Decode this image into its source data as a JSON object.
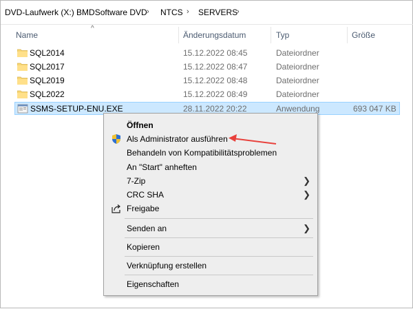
{
  "breadcrumb": {
    "items": [
      "DVD-Laufwerk (X:) BMDSoftware DVD",
      "NTCS",
      "SERVERS"
    ]
  },
  "columns": {
    "name": "Name",
    "date": "Änderungsdatum",
    "type": "Typ",
    "size": "Größe"
  },
  "files": [
    {
      "name": "SQL2014",
      "date": "15.12.2022 08:45",
      "type": "Dateiordner",
      "size": "",
      "icon": "folder-icon"
    },
    {
      "name": "SQL2017",
      "date": "15.12.2022 08:47",
      "type": "Dateiordner",
      "size": "",
      "icon": "folder-icon"
    },
    {
      "name": "SQL2019",
      "date": "15.12.2022 08:48",
      "type": "Dateiordner",
      "size": "",
      "icon": "folder-icon"
    },
    {
      "name": "SQL2022",
      "date": "15.12.2022 08:49",
      "type": "Dateiordner",
      "size": "",
      "icon": "folder-icon"
    },
    {
      "name": "SSMS-SETUP-ENU.EXE",
      "date": "28.11.2022 20:22",
      "type": "Anwendung",
      "size": "693 047 KB",
      "icon": "installer-icon",
      "selected": true
    }
  ],
  "context_menu": {
    "open": "Öffnen",
    "run_as_admin": "Als Administrator ausführen",
    "compat": "Behandeln von Kompatibilitätsproblemen",
    "pin_start": "An \"Start\" anheften",
    "zip": "7-Zip",
    "crc": "CRC SHA",
    "share": "Freigabe",
    "send_to": "Senden an",
    "copy": "Kopieren",
    "shortcut": "Verknüpfung erstellen",
    "properties": "Eigenschaften"
  },
  "colors": {
    "selection": "#cce8ff",
    "folder": "#f8d775",
    "annotation_arrow": "#e8413c"
  }
}
